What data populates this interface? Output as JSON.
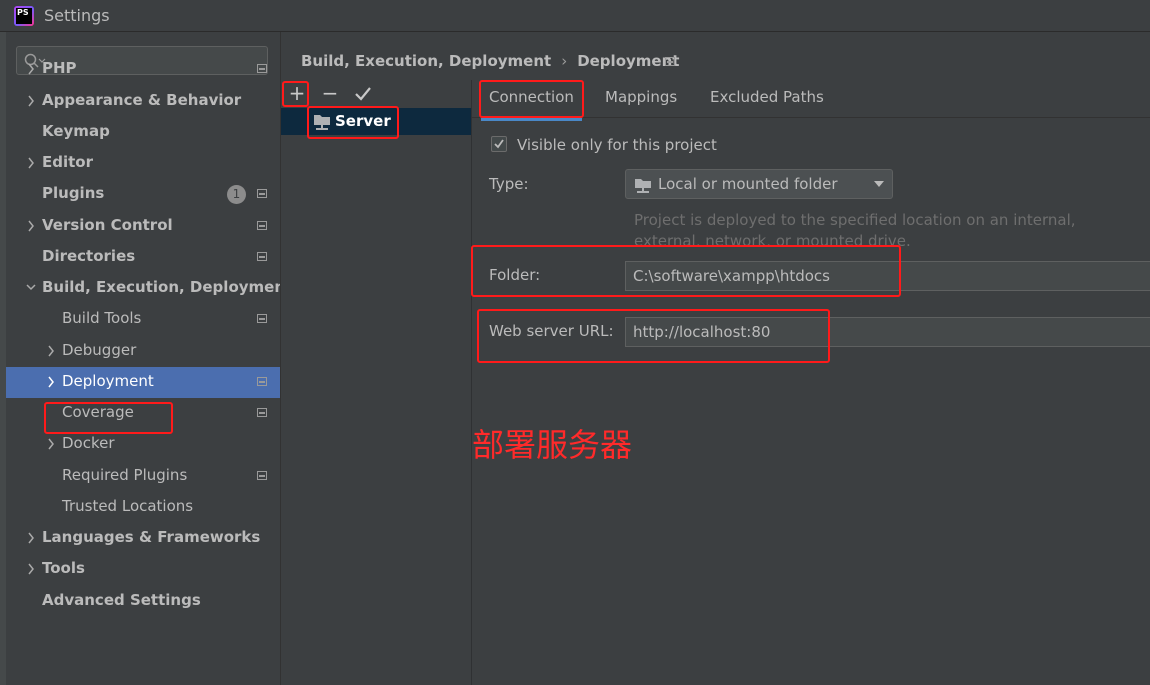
{
  "window": {
    "title": "Settings",
    "app_icon_text": "PS"
  },
  "search": {
    "placeholder": ""
  },
  "sidebar": {
    "items": [
      {
        "label": "PHP",
        "level": 0,
        "chevron": true,
        "bold": true,
        "proj": true
      },
      {
        "label": "Appearance & Behavior",
        "level": 0,
        "chevron": true,
        "bold": true,
        "proj": false
      },
      {
        "label": "Keymap",
        "level": 0,
        "chevron": false,
        "bold": true,
        "proj": false
      },
      {
        "label": "Editor",
        "level": 0,
        "chevron": true,
        "bold": true,
        "proj": false
      },
      {
        "label": "Plugins",
        "level": 0,
        "chevron": false,
        "bold": true,
        "proj": true,
        "badge": "1"
      },
      {
        "label": "Version Control",
        "level": 0,
        "chevron": true,
        "bold": true,
        "proj": true
      },
      {
        "label": "Directories",
        "level": 0,
        "chevron": false,
        "bold": true,
        "proj": true
      },
      {
        "label": "Build, Execution, Deployment",
        "level": 0,
        "chevron": "down",
        "bold": true,
        "proj": false
      },
      {
        "label": "Build Tools",
        "level": 1,
        "chevron": false,
        "bold": false,
        "proj": true
      },
      {
        "label": "Debugger",
        "level": 1,
        "chevron": true,
        "bold": false,
        "proj": false
      },
      {
        "label": "Deployment",
        "level": 1,
        "chevron": true,
        "bold": false,
        "proj": true,
        "selected": true
      },
      {
        "label": "Coverage",
        "level": 1,
        "chevron": false,
        "bold": false,
        "proj": true
      },
      {
        "label": "Docker",
        "level": 1,
        "chevron": true,
        "bold": false,
        "proj": false
      },
      {
        "label": "Required Plugins",
        "level": 1,
        "chevron": false,
        "bold": false,
        "proj": true
      },
      {
        "label": "Trusted Locations",
        "level": 1,
        "chevron": false,
        "bold": false,
        "proj": false
      },
      {
        "label": "Languages & Frameworks",
        "level": 0,
        "chevron": true,
        "bold": true,
        "proj": false
      },
      {
        "label": "Tools",
        "level": 0,
        "chevron": true,
        "bold": true,
        "proj": false
      },
      {
        "label": "Advanced Settings",
        "level": 0,
        "chevron": false,
        "bold": true,
        "proj": false
      }
    ]
  },
  "breadcrumb": {
    "parent": "Build, Execution, Deployment",
    "separator": "›",
    "current": "Deployment"
  },
  "server_list": {
    "toolbar": {
      "add": "+",
      "remove": "−"
    },
    "servers": [
      {
        "label": "Server"
      }
    ]
  },
  "tabs": [
    {
      "label": "Connection"
    },
    {
      "label": "Mappings"
    },
    {
      "label": "Excluded Paths"
    }
  ],
  "connection": {
    "visible_only_label": "Visible only for this project",
    "visible_only_checked": true,
    "type_label": "Type:",
    "type_value": "Local or mounted folder",
    "type_hint": "Project is deployed to the specified location on an internal, external, network, or mounted drive.",
    "folder_label": "Folder:",
    "folder_value": "C:\\software\\xampp\\htdocs",
    "url_label": "Web server URL:",
    "url_value": "http://localhost:80"
  },
  "annotation": {
    "note": "部署服务器",
    "color": "#ff1a1a"
  },
  "colors": {
    "background": "#3c3f41",
    "selected": "#4b6eaf",
    "server_selected": "#0d293e",
    "annotation": "#ff1a1a"
  }
}
